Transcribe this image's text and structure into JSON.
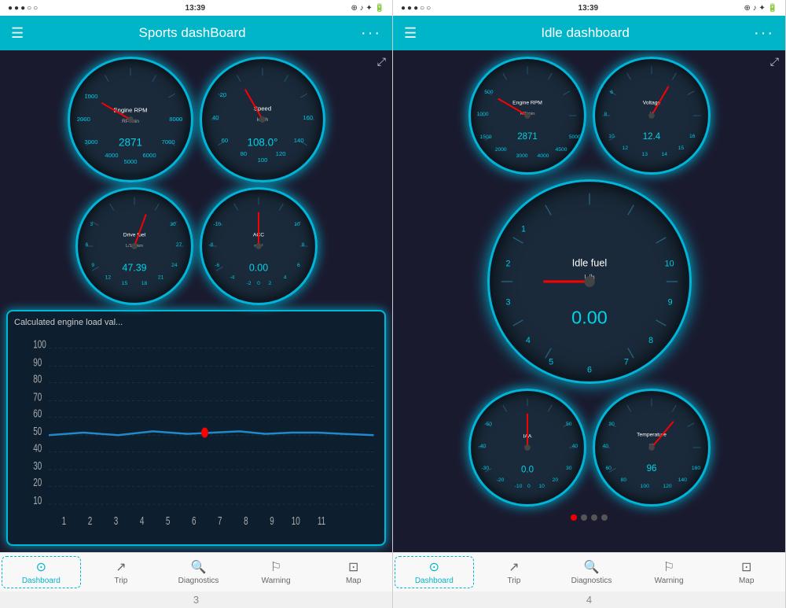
{
  "left_phone": {
    "status_bar": {
      "dots": "●●●○○",
      "signal": "●●●○○",
      "time": "13:39",
      "icons": "⊕ ♪ ✦ 🔋"
    },
    "nav_bar": {
      "menu_icon": "☰",
      "title": "Sports dashBoard",
      "more_icon": "···"
    },
    "gauges": {
      "rpm": {
        "label": "Engine RPM",
        "unit": "RP/min",
        "value": "2871",
        "needle_deg": "-60"
      },
      "speed": {
        "label": "Speed",
        "unit": "km/h",
        "value": "108.0°",
        "needle_deg": "-30"
      },
      "drive_fuel": {
        "label": "Drive fuel",
        "unit": "L/100km",
        "value": "47.39",
        "needle_deg": "20"
      },
      "acc": {
        "label": "ACC",
        "unit": "m/s²",
        "value": "0.00",
        "needle_deg": "0"
      }
    },
    "chart": {
      "title": "Calculated engine load val...",
      "y_labels": [
        "100",
        "90",
        "80",
        "70",
        "60",
        "50",
        "40",
        "30",
        "20",
        "10"
      ],
      "x_labels": [
        "1",
        "2",
        "3",
        "4",
        "5",
        "6",
        "7",
        "8",
        "9",
        "10",
        "11"
      ]
    },
    "tab_bar": {
      "tabs": [
        {
          "id": "dashboard",
          "icon": "⊙",
          "label": "Dashboard",
          "active": true
        },
        {
          "id": "trip",
          "icon": "↗",
          "label": "Trip",
          "active": false
        },
        {
          "id": "diagnostics",
          "icon": "🔍",
          "label": "Diagnostics",
          "active": false
        },
        {
          "id": "warning",
          "icon": "⚐",
          "label": "Warning",
          "active": false
        },
        {
          "id": "map",
          "icon": "⊡",
          "label": "Map",
          "active": false
        }
      ]
    },
    "page_number": "3"
  },
  "right_phone": {
    "status_bar": {
      "dots": "●●●○○",
      "time": "13:39",
      "icons": "⊕ ♪ ✦ 🔋"
    },
    "nav_bar": {
      "menu_icon": "☰",
      "title": "Idle dashboard",
      "more_icon": "···"
    },
    "gauges": {
      "rpm": {
        "label": "Engine RPM",
        "unit": "RP/min",
        "value": "2871",
        "needle_deg": "-60"
      },
      "voltage": {
        "label": "Voltage",
        "unit": "V",
        "value": "12.4",
        "needle_deg": "30"
      },
      "idle_fuel": {
        "label": "Idle fuel",
        "unit": "L/h",
        "value": "0.00",
        "needle_deg": "-90"
      },
      "iaa": {
        "label": "IAA",
        "unit": "",
        "value": "0.0",
        "needle_deg": "0"
      },
      "temperature": {
        "label": "Temperature",
        "unit": "°C",
        "value": "96",
        "needle_deg": "40"
      }
    },
    "tab_bar": {
      "tabs": [
        {
          "id": "dashboard",
          "icon": "⊙",
          "label": "Dashboard",
          "active": true
        },
        {
          "id": "trip",
          "icon": "↗",
          "label": "Trip",
          "active": false
        },
        {
          "id": "diagnostics",
          "icon": "🔍",
          "label": "Diagnostics",
          "active": false
        },
        {
          "id": "warning",
          "icon": "⚐",
          "label": "Warning",
          "active": false
        },
        {
          "id": "map",
          "icon": "⊡",
          "label": "Map",
          "active": false
        }
      ]
    },
    "page_number": "4"
  }
}
